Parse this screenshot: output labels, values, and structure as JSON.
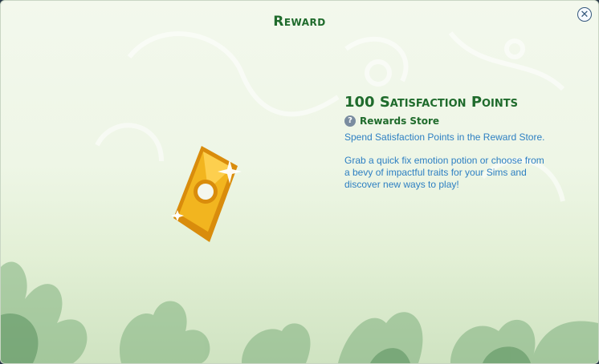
{
  "dialog": {
    "title": "Reward",
    "close_icon": "close-icon",
    "reward_icon": "satisfaction-points-icon"
  },
  "reward": {
    "name": "100 Satisfaction Points",
    "help_icon": "help-icon",
    "help_glyph": "?",
    "source": "Rewards Store",
    "description_1": "Spend Satisfaction Points in the Reward Store.",
    "description_2": "Grab a quick fix emotion potion or choose from a bevy of impactful traits for your Sims and discover new ways to play!"
  },
  "colors": {
    "title_green": "#1f6b2c",
    "body_blue": "#2d7fc2",
    "icon_gold": "#f2b51f"
  }
}
